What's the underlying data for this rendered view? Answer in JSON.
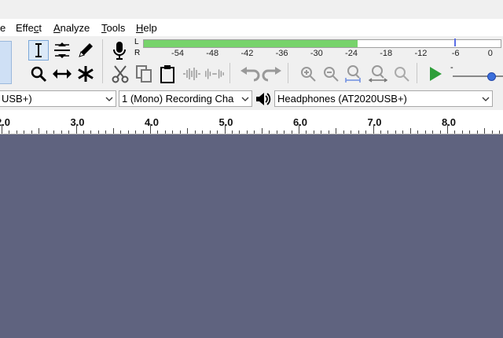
{
  "menu": {
    "items": [
      {
        "name": "menu-file",
        "label": "e",
        "underline_index": -1
      },
      {
        "name": "menu-effect",
        "pre": "Effe",
        "ul": "c",
        "post": "t"
      },
      {
        "name": "menu-analyze",
        "pre": "",
        "ul": "A",
        "post": "nalyze"
      },
      {
        "name": "menu-tools",
        "pre": "",
        "ul": "T",
        "post": "ools"
      },
      {
        "name": "menu-help",
        "pre": "",
        "ul": "H",
        "post": "elp"
      }
    ]
  },
  "meter": {
    "left_label": "L",
    "right_label": "R",
    "ticks": [
      "-54",
      "-48",
      "-42",
      "-36",
      "-30",
      "-24",
      "-18",
      "-12",
      "-6",
      "0"
    ],
    "level_fraction": 0.6,
    "peak_tick": "-6",
    "color_fill": "#77d36b",
    "color_peak": "#5a6ee6"
  },
  "slider": {
    "minus_label": "-"
  },
  "devices": {
    "host_value": "USB+)",
    "channels_value": "1 (Mono) Recording Cha",
    "output_value": "Headphones (AT2020USB+)"
  },
  "ruler": {
    "labels": [
      "2.0",
      "3.0",
      "4.0",
      "5.0",
      "6.0",
      "7.0",
      "8.0"
    ]
  },
  "colors": {
    "track_bg": "#5f637f",
    "play_green": "#2e9e3a",
    "accent_blue": "#3b6fdc"
  },
  "icons": {
    "selection": "i-beam-icon",
    "envelope": "envelope-icon",
    "draw": "pencil-icon",
    "record_meter": "microphone-icon",
    "zoom": "magnifier-icon",
    "timeshift": "double-arrow-icon",
    "multi": "asterisk-icon",
    "cut": "scissors-icon",
    "copy": "copy-icon",
    "paste": "clipboard-icon",
    "trim": "trim-audio-icon",
    "silence": "silence-audio-icon",
    "undo": "undo-icon",
    "redo": "redo-icon",
    "zoom_in": "zoom-in-icon",
    "zoom_out": "zoom-out-icon",
    "fit_selection": "fit-selection-icon",
    "fit_project": "fit-project-icon",
    "zoom_toggle": "zoom-toggle-icon",
    "play": "play-icon",
    "speaker": "speaker-icon"
  }
}
